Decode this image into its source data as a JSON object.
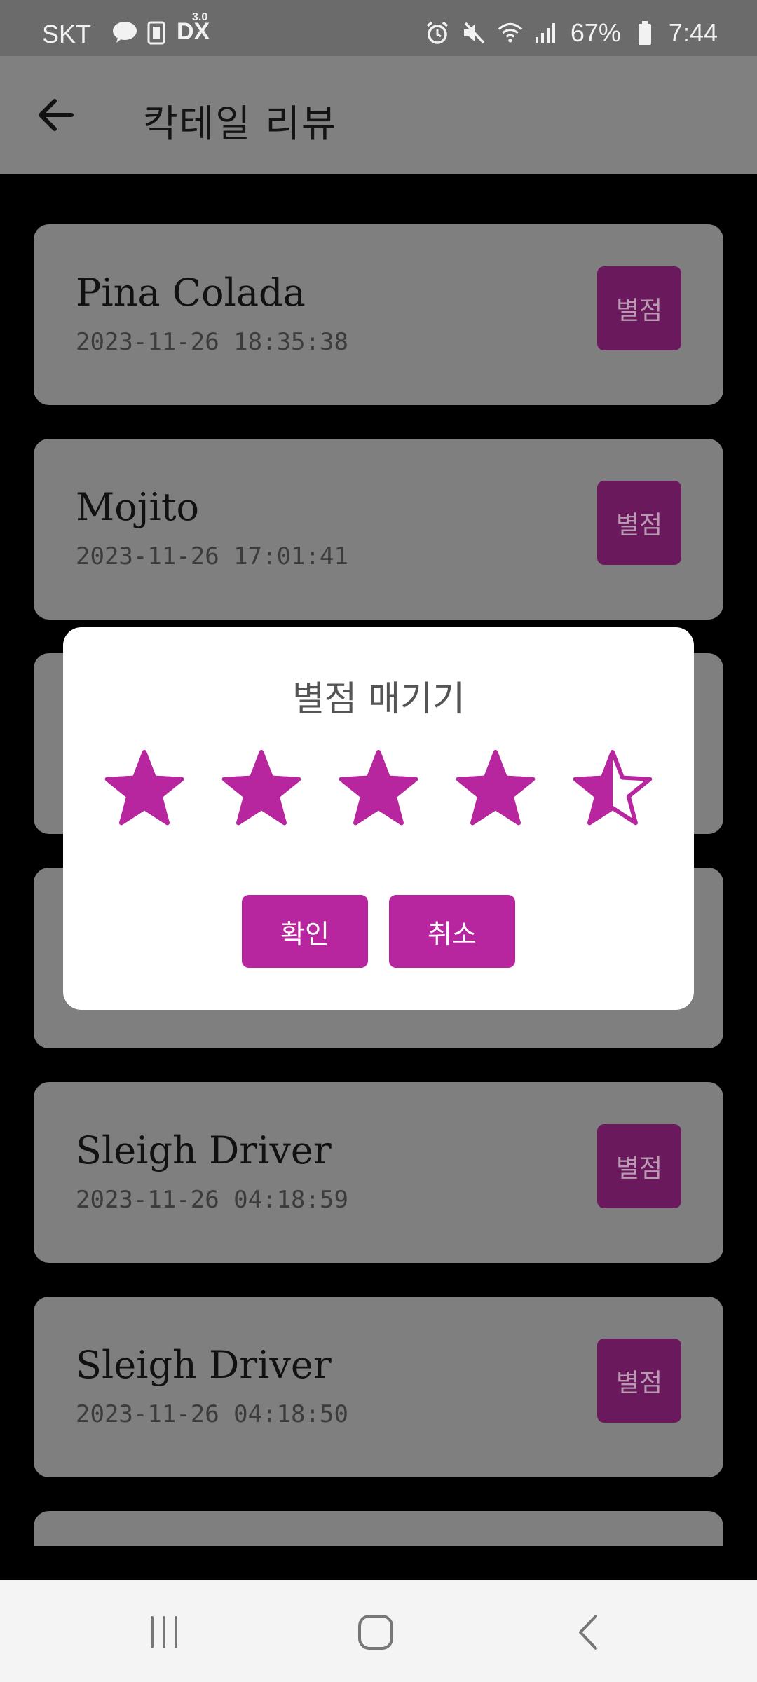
{
  "status_bar": {
    "carrier": "SKT",
    "left_icons": [
      "talk-icon",
      "sim-icon",
      "dx-icon"
    ],
    "dx_label": "DX",
    "dx_badge": "3.0",
    "battery": "67%",
    "time": "7:44",
    "right_icons": [
      "alarm-icon",
      "mute-icon",
      "wifi-icon",
      "signal-icon",
      "battery-icon"
    ]
  },
  "app_bar": {
    "title": "칵테일 리뷰"
  },
  "list": {
    "rate_label": "별점",
    "items": [
      {
        "name": "Pina Colada",
        "date": "2023-11-26 18:35:38"
      },
      {
        "name": "Mojito",
        "date": "2023-11-26 17:01:41"
      },
      {
        "name": "",
        "date": ""
      },
      {
        "name": "",
        "date": ""
      },
      {
        "name": "Sleigh Driver",
        "date": "2023-11-26 04:18:59"
      },
      {
        "name": "Sleigh Driver",
        "date": "2023-11-26 04:18:50"
      },
      {
        "name": "",
        "date": ""
      }
    ]
  },
  "dialog": {
    "title": "별점 매기기",
    "rating": 4.5,
    "max_rating": 5,
    "confirm_label": "확인",
    "cancel_label": "취소"
  },
  "colors": {
    "accent": "#b8269f",
    "accent_dimmed": "#6a1a5c",
    "card_dimmed": "#7f7f7f",
    "dialog_bg": "#ffffff"
  }
}
